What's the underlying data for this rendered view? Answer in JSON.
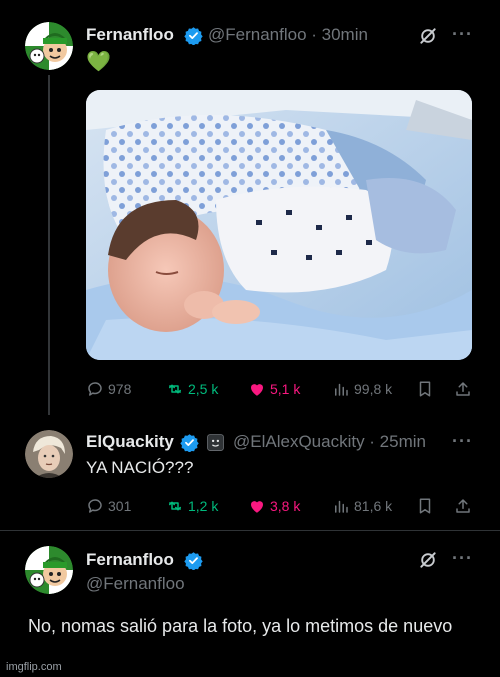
{
  "tweet1": {
    "name": "Fernanfloo",
    "handle": "@Fernanfloo · 30min",
    "emoji": "💚",
    "stats": {
      "replies": "978",
      "retweets": "2,5 k",
      "likes": "5,1 k",
      "views": "99,8 k"
    }
  },
  "tweet2": {
    "name": "ElQuackity",
    "handle": "@ElAlexQuackity · 25min",
    "text": "YA NACIÓ???",
    "stats": {
      "replies": "301",
      "retweets": "1,2 k",
      "likes": "3,8 k",
      "views": "81,6 k"
    }
  },
  "tweet3": {
    "name": "Fernanfloo",
    "handle": "@Fernanfloo",
    "text": "No, nomas salió para la foto, ya lo metimos de nuevo"
  },
  "watermark": "imgflip.com",
  "colors": {
    "background": "#000000",
    "verified": "#1d9bf0",
    "retweet": "#00ba7c",
    "like": "#f91880",
    "muted": "#71767b"
  }
}
